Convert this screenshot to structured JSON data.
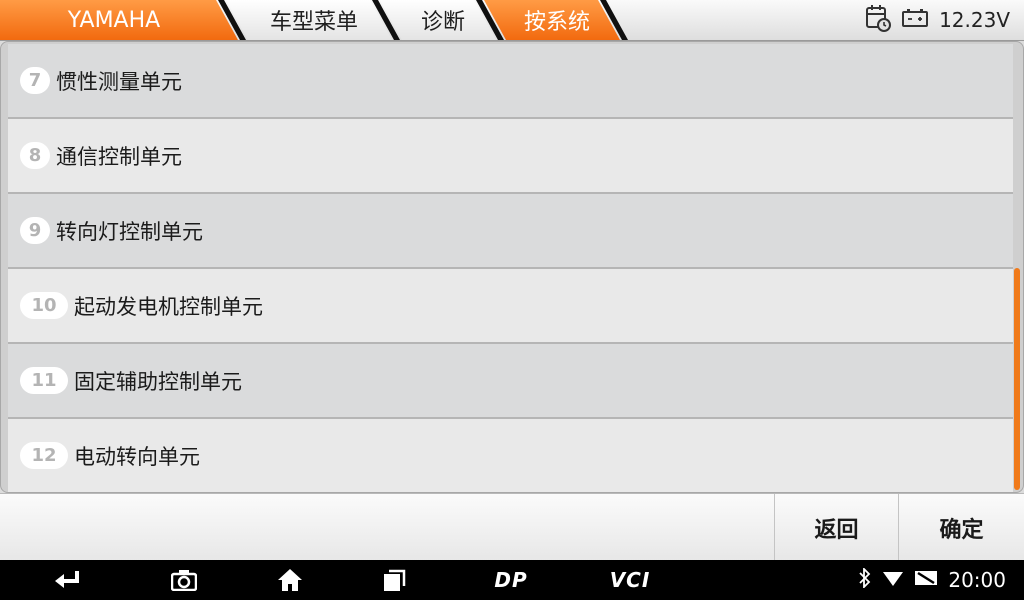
{
  "breadcrumb": {
    "items": [
      {
        "label": "YAMAHA",
        "active": true
      },
      {
        "label": "车型菜单",
        "active": false
      },
      {
        "label": "诊断",
        "active": false
      },
      {
        "label": "按系统",
        "active": true
      }
    ]
  },
  "status": {
    "voltage": "12.23V",
    "icons": [
      "calendar-clock-icon",
      "battery-icon"
    ]
  },
  "list": {
    "items": [
      {
        "num": "7",
        "label": "惯性测量单元"
      },
      {
        "num": "8",
        "label": "通信控制单元"
      },
      {
        "num": "9",
        "label": "转向灯控制单元"
      },
      {
        "num": "10",
        "label": "起动发电机控制单元"
      },
      {
        "num": "11",
        "label": "固定辅助控制单元"
      },
      {
        "num": "12",
        "label": "电动转向单元"
      }
    ],
    "scroll_position": 0.5
  },
  "actions": {
    "back_label": "返回",
    "confirm_label": "确定"
  },
  "navbar": {
    "dp_label": "DP",
    "vci_label": "VCI",
    "time": "20:00"
  },
  "colors": {
    "accent": "#f26a0f",
    "scroll_thumb": "#f07a1a"
  }
}
